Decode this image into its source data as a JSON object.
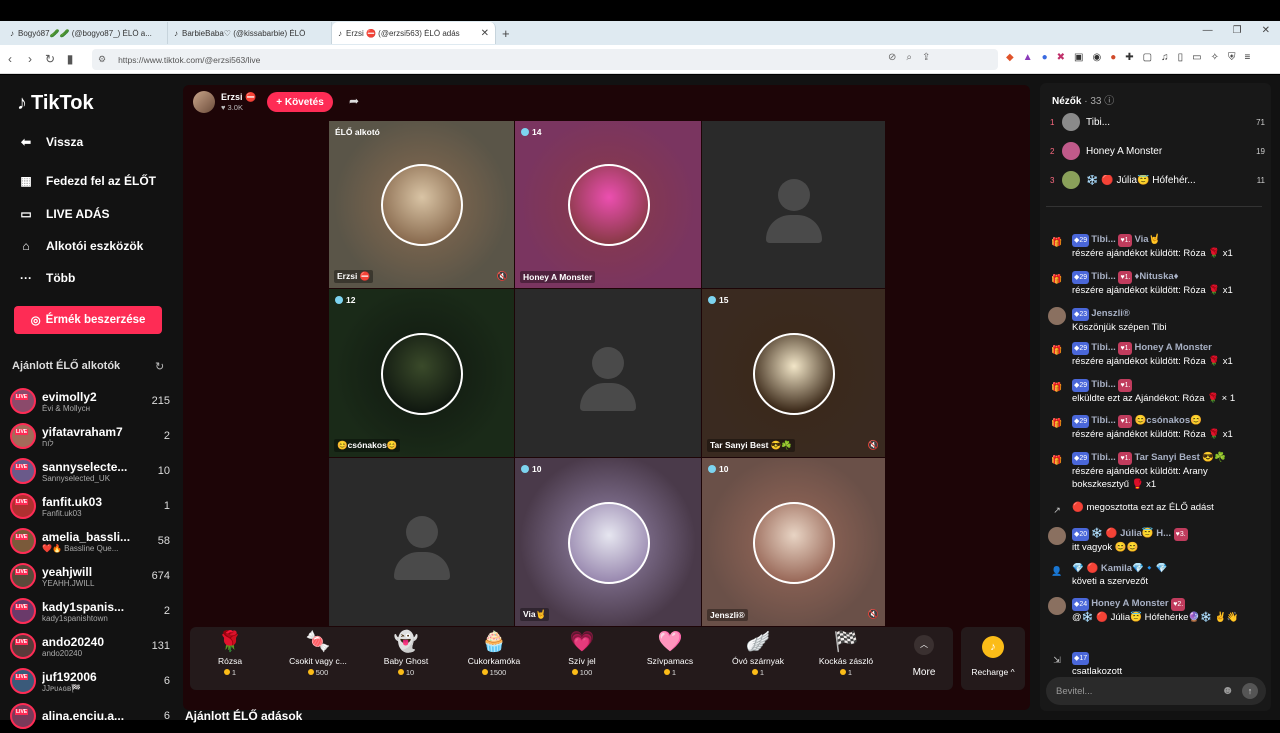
{
  "browser": {
    "tabs": [
      {
        "title": "Bogyó87🥒🥒 (@bogyo87_) ÉLŐ a...",
        "active": false
      },
      {
        "title": "BarbieBaba♡ (@kissabarbie) ÉLŐ",
        "active": false
      },
      {
        "title": "Erzsi ⛔ (@erzsi563) ÉLŐ adás",
        "active": true
      }
    ],
    "url": "https://www.tiktok.com/@erzsi563/live"
  },
  "sidebar": {
    "logo": "TikTok",
    "nav": [
      {
        "label": "Vissza",
        "icon": "back-icon"
      },
      {
        "label": "Fedezd fel az ÉLŐT",
        "icon": "calendar-icon"
      },
      {
        "label": "LIVE ADÁS",
        "icon": "camera-icon"
      },
      {
        "label": "Alkotói eszközök",
        "icon": "home-icon"
      },
      {
        "label": "Több",
        "icon": "more-icon"
      }
    ],
    "coin_button": "Érmék beszerzése",
    "recommended_title": "Ajánlott ÉLŐ alkotók",
    "creators": [
      {
        "name": "evimolly2",
        "sub": "Évi & Mollyсн",
        "count": "215",
        "color": "#8b4a6b"
      },
      {
        "name": "yifatavraham7",
        "sub": "לוח",
        "count": "2",
        "color": "#a36b5a"
      },
      {
        "name": "sannyselecte...",
        "sub": "Sannyselected_UK",
        "count": "10",
        "color": "#6a5a8a"
      },
      {
        "name": "fanfit.uk03",
        "sub": "Fanfit.uk03",
        "count": "1",
        "color": "#b03030"
      },
      {
        "name": "amelia_bassli...",
        "sub": "❤️🔥 Bassline Que...",
        "count": "58",
        "color": "#7a5a3a"
      },
      {
        "name": "yeahjwill",
        "sub": "YEAHH.JWILL",
        "count": "674",
        "color": "#5a4a3a"
      },
      {
        "name": "kady1spanis...",
        "sub": "kady1spanishtown",
        "count": "2",
        "color": "#6a3a6a"
      },
      {
        "name": "ando20240",
        "sub": "ando20240",
        "count": "131",
        "color": "#5a3a3a"
      },
      {
        "name": "juf192006",
        "sub": "JJᴘᴜᴀɢʙ🏁",
        "count": "6",
        "color": "#3a5a7a"
      },
      {
        "name": "alina.enciu.a...",
        "sub": "",
        "count": "6",
        "color": "#7a3a5a"
      }
    ]
  },
  "host": {
    "name": "Erzsi ⛔",
    "likes": "♥ 3.0K",
    "follow": "+ Követés"
  },
  "tiles": [
    {
      "badge": "ÉLŐ alkotó",
      "name": "Erzsi ⛔",
      "type": "circle",
      "bg": "#5a5548",
      "c1": "#d9c4a5",
      "c2": "#8a6c50",
      "mute": true
    },
    {
      "badge": "14",
      "name": "Honey A Monster",
      "type": "circle",
      "bg": "#7a3560",
      "c1": "#ec4fb0",
      "c2": "#8a3a48",
      "mute": false
    },
    {
      "badge": "",
      "name": "",
      "type": "placeholder",
      "bg": "#2a2a2a",
      "mute": false
    },
    {
      "badge": "12",
      "name": "😊csónakos😊",
      "type": "circle",
      "bg": "#1a2a18",
      "c1": "#3a4a2a",
      "c2": "#101810",
      "mute": false
    },
    {
      "badge": "",
      "name": "",
      "type": "placeholder",
      "bg": "#2a2a2a",
      "mute": false
    },
    {
      "badge": "15",
      "name": "Tar Sanyi Best 😎☘️",
      "type": "circle",
      "bg": "#3a2a20",
      "c1": "#f2e6c8",
      "c2": "#3a2818",
      "mute": true
    },
    {
      "badge": "",
      "name": "",
      "type": "placeholder",
      "bg": "#2a2a2a",
      "mute": false
    },
    {
      "badge": "10",
      "name": "Via🤘",
      "type": "circle",
      "bg": "#4a3a4a",
      "c1": "#e6e6f0",
      "c2": "#9a8ab0",
      "mute": false
    },
    {
      "badge": "10",
      "name": "Jenszli®",
      "type": "circle",
      "bg": "#6a5048",
      "c1": "#e8d4c4",
      "c2": "#9a6a5a",
      "mute": true
    }
  ],
  "gifts": [
    {
      "name": "Rózsa",
      "price": "1",
      "icon": "🌹"
    },
    {
      "name": "Csokit vagy c...",
      "price": "500",
      "icon": "🍬"
    },
    {
      "name": "Baby Ghost",
      "price": "10",
      "icon": "👻"
    },
    {
      "name": "Cukorkamóka",
      "price": "1500",
      "icon": "🧁"
    },
    {
      "name": "Szív jel",
      "price": "100",
      "icon": "💗"
    },
    {
      "name": "Szívpamacs",
      "price": "1",
      "icon": "🩷"
    },
    {
      "name": "Óvó szárnyak",
      "price": "1",
      "icon": "🪽"
    },
    {
      "name": "Kockás zászló",
      "price": "1",
      "icon": "🏁"
    }
  ],
  "more_label": "More",
  "recharge_label": "Recharge ^",
  "bottom_title": "Ajánlott ÉLŐ adások",
  "chat": {
    "viewers_label": "Nézők",
    "viewers_count": "· 33",
    "top": [
      {
        "rank": "1",
        "name": "Tibi...",
        "value": "71",
        "color": "#8a8a8a"
      },
      {
        "rank": "2",
        "name": "Honey A Monster",
        "value": "19",
        "color": "#c05a8a"
      },
      {
        "rank": "3",
        "name": "❄️ 🔴 Júlia😇 Hófehér...",
        "value": "11",
        "color": "#8aa05a"
      }
    ],
    "messages": [
      {
        "icon": "🎁",
        "user": "Tibi...",
        "extra": "Via🤘",
        "text": "részére ajándékot küldött: Róza 🌹 x1",
        "lvl": "29",
        "fan": "1."
      },
      {
        "icon": "🎁",
        "user": "Tibi...",
        "extra": "♦Nituska♦",
        "text": "részére ajándékot küldött: Róza 🌹 x1",
        "lvl": "29",
        "fan": "1."
      },
      {
        "icon": "",
        "user": "Jenszli®",
        "extra": "",
        "text": "Köszönjük szépen Tibi",
        "lvl": "23",
        "fan": ""
      },
      {
        "icon": "🎁",
        "user": "Tibi...",
        "extra": "Honey A Monster",
        "text": "részére ajándékot küldött: Róza 🌹 x1",
        "lvl": "29",
        "fan": "1."
      },
      {
        "icon": "🎁",
        "user": "Tibi...",
        "extra": "",
        "text": "elküldte ezt az Ajándékot: Róza 🌹 × 1",
        "lvl": "29",
        "fan": "1."
      },
      {
        "icon": "🎁",
        "user": "Tibi...",
        "extra": "😊csónakos😊",
        "text": "részére ajándékot küldött: Róza 🌹 x1",
        "lvl": "29",
        "fan": "1."
      },
      {
        "icon": "🎁",
        "user": "Tibi...",
        "extra": "Tar Sanyi Best 😎☘️",
        "text": "részére ajándékot küldött: Arany bokszkesztyű 🥊 x1",
        "lvl": "29",
        "fan": "1."
      },
      {
        "icon": "↗",
        "user": "",
        "extra": "",
        "text": "🔴 megosztotta ezt az ÉLŐ adást",
        "lvl": "",
        "fan": ""
      },
      {
        "icon": "",
        "user": "❄️ 🔴 Júlia😇 H...",
        "extra": "",
        "text": "itt vagyok 😊😊",
        "lvl": "20",
        "fan": "3."
      },
      {
        "icon": "👤",
        "user": "💎 🔴 Kamila💎🔹💎",
        "extra": "",
        "text": "követi a szervezőt",
        "lvl": "",
        "fan": ""
      },
      {
        "icon": "",
        "user": "Honey A Monster",
        "extra": "",
        "text": "@❄️ 🔴 Júlia😇 Hófehérke🔮❄️ ✌️👋",
        "lvl": "24",
        "fan": "2."
      },
      {
        "icon": "⇲",
        "user": "",
        "extra": "",
        "text": "csatlakozott",
        "lvl": "17",
        "fan": ""
      }
    ],
    "input_placeholder": "Bevitel..."
  }
}
